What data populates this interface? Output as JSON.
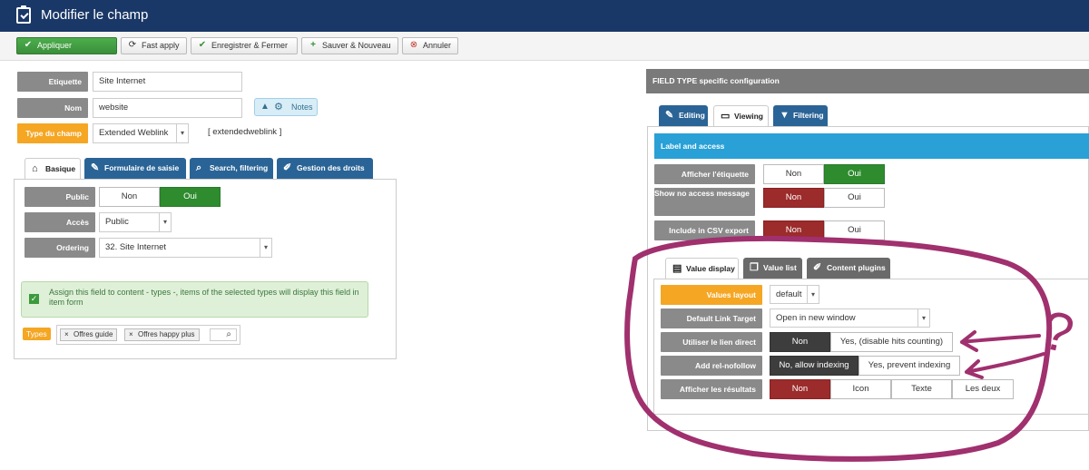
{
  "header": {
    "title": "Modifier le champ"
  },
  "toolbar": {
    "apply": "Appliquer",
    "fast_apply": "Fast apply",
    "save_close": "Enregistrer & Fermer",
    "save_new": "Sauver & Nouveau",
    "cancel": "Annuler"
  },
  "fields": {
    "etiquette_label": "Etiquette",
    "etiquette_value": "Site Internet",
    "nom_label": "Nom",
    "nom_value": "website",
    "notes_label": "Notes",
    "type_label": "Type du champ",
    "type_value": "Extended Weblink",
    "type_code": "[ extendedweblink ]"
  },
  "left_tabs": [
    "Basique",
    "Formulaire de saisie",
    "Search, filtering",
    "Gestion des droits"
  ],
  "basic": {
    "public_label": "Public",
    "public_no": "Non",
    "public_yes": "Oui",
    "access_label": "Accès",
    "access_value": "Public",
    "ordering_label": "Ordering",
    "ordering_value": "32. Site Internet",
    "assign_text": "Assign this field to content - types -, items of the selected types will display this field in item form",
    "types_label": "Types",
    "type_tags": [
      "Offres guide",
      "Offres happy plus"
    ]
  },
  "right": {
    "header": "FIELD TYPE specific configuration",
    "tabs": [
      "Editing",
      "Viewing",
      "Filtering"
    ],
    "section_title": "Label and access",
    "show_label": "Afficher l'étiquette",
    "show_no": "Non",
    "show_yes": "Oui",
    "no_access_label": "Show no access message",
    "no_access_no": "Non",
    "no_access_yes": "Oui",
    "csv_label": "Include in CSV export",
    "csv_no": "Non",
    "csv_yes": "Oui",
    "subtabs": [
      "Value display",
      "Value list",
      "Content plugins"
    ],
    "values_layout_label": "Values layout",
    "values_layout_value": "default",
    "link_target_label": "Default Link Target",
    "link_target_value": "Open in new window",
    "direct_link_label": "Utiliser le lien direct",
    "direct_link_no": "Non",
    "direct_link_yes": "Yes, (disable hits counting)",
    "nofollow_label": "Add rel-nofollow",
    "nofollow_no": "No, allow indexing",
    "nofollow_yes": "Yes, prevent indexing",
    "results_label": "Afficher les résultats",
    "results_options": [
      "Non",
      "Icon",
      "Texte",
      "Les deux"
    ]
  },
  "annotation": {
    "question_mark": "?"
  },
  "colors": {
    "header": "#1a3867",
    "tab": "#2a6496",
    "section": "#29a0d6",
    "annotation": "#a0306e"
  }
}
